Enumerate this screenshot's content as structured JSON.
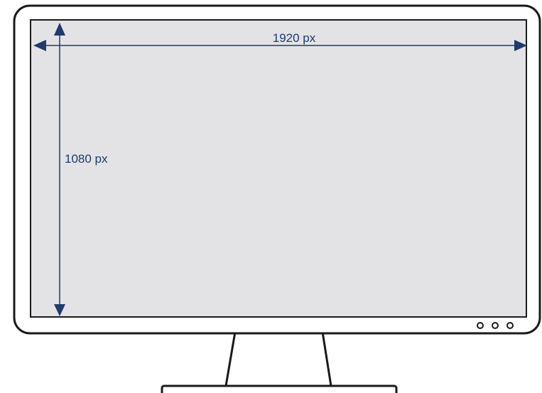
{
  "diagram": {
    "width_label": "1920 px",
    "height_label": "1080 px",
    "colors": {
      "outline": "#1a1a1a",
      "screen_fill": "#e3e3e6",
      "arrow": "#1f3a6b",
      "label": "#1f3a6b",
      "background": "#ffffff"
    },
    "icons": [
      "monitor-icon",
      "indicator-dot-icon"
    ]
  }
}
